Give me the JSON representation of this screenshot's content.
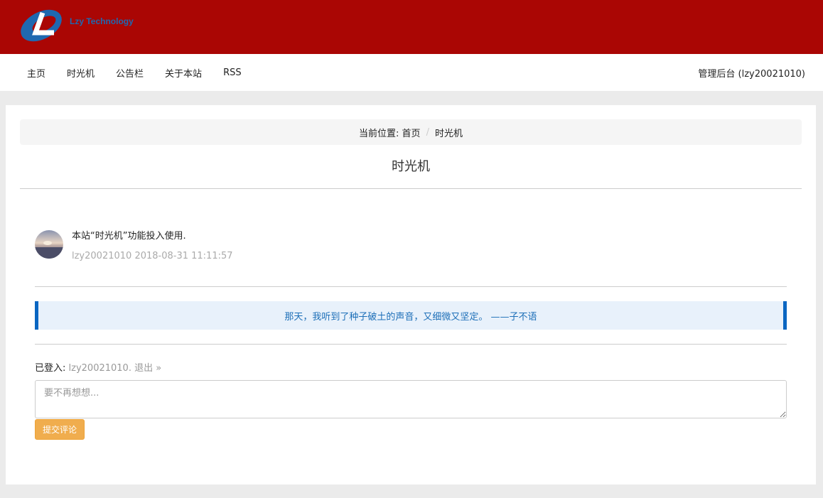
{
  "header": {
    "logo_text": "Lzy Technology"
  },
  "nav": {
    "items": [
      "主页",
      "时光机",
      "公告栏",
      "关于本站",
      "RSS"
    ],
    "admin": "管理后台 (lzy20021010)"
  },
  "breadcrumb": {
    "prefix": "当前位置:",
    "home": "首页",
    "separator": "/",
    "current": "时光机"
  },
  "page": {
    "title": "时光机"
  },
  "post": {
    "content": "本站“时光机”功能投入使用.",
    "author": "lzy20021010",
    "date": "2018-08-31 11:11:57"
  },
  "quote": {
    "text": "那天，我听到了种子破土的声音，又细微又坚定。 ——子不语"
  },
  "comment": {
    "logged_in_label": "已登入:",
    "username": "lzy20021010",
    "logout": "退出 »",
    "placeholder": "要不再想想...",
    "submit_label": "提交评论"
  },
  "colors": {
    "header_bg": "#aa0604",
    "accent_blue": "#0a66c2",
    "button": "#f0ad4e"
  }
}
